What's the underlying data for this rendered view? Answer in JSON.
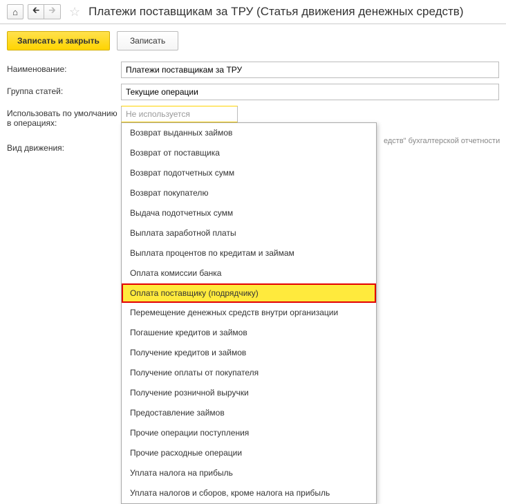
{
  "header": {
    "title": "Платежи поставщикам за ТРУ (Статья движения денежных средств)"
  },
  "actions": {
    "primary": "Записать и закрыть",
    "secondary": "Записать"
  },
  "form": {
    "name_label": "Наименование:",
    "name_value": "Платежи поставщикам за ТРУ",
    "group_label": "Группа статей:",
    "group_value": "Текущие операции",
    "default_label": "Использовать по умолчанию в операциях:",
    "default_value": "Не используется",
    "movement_label": "Вид движения:"
  },
  "hint": "едств\" бухгалтерской отчетности",
  "dropdown": {
    "selected_index": 8,
    "items": [
      "Возврат выданных займов",
      "Возврат от поставщика",
      "Возврат подотчетных сумм",
      "Возврат покупателю",
      "Выдача подотчетных сумм",
      "Выплата заработной платы",
      "Выплата процентов по кредитам и займам",
      "Оплата комиссии банка",
      "Оплата поставщику (подрядчику)",
      "Перемещение денежных средств внутри организации",
      "Погашение кредитов и займов",
      "Получение кредитов и займов",
      "Получение оплаты от покупателя",
      "Получение розничной выручки",
      "Предоставление займов",
      "Прочие операции поступления",
      "Прочие расходные операции",
      "Уплата налога на прибыль",
      "Уплата налогов и сборов, кроме налога на прибыль"
    ]
  }
}
